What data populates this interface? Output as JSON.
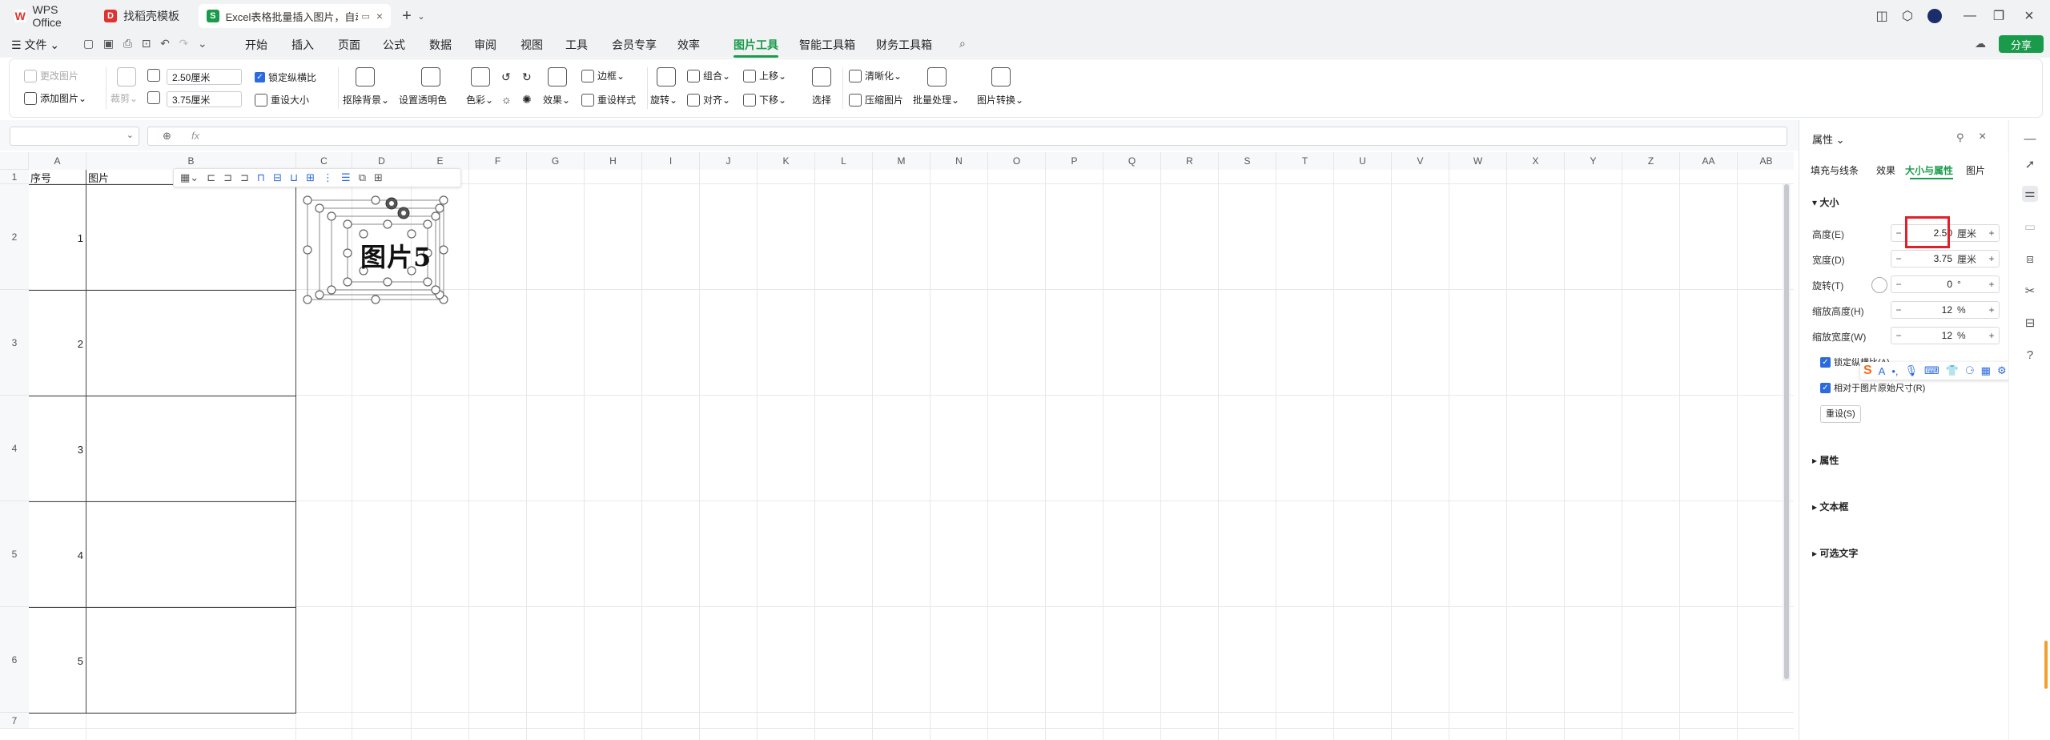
{
  "titlebar": {
    "tabs": [
      {
        "label": "WPS Office",
        "icon": "wps-logo-icon",
        "color": "#e0322f"
      },
      {
        "label": "找稻壳模板",
        "icon": "docer-logo-icon",
        "color": "#e0322f"
      },
      {
        "label": "Excel表格批量插入图片，自动",
        "icon": "spreadsheet-icon",
        "color": "#1a9b4b"
      }
    ],
    "new_tab": "+"
  },
  "menu": {
    "file": "文件",
    "items": [
      "开始",
      "插入",
      "页面",
      "公式",
      "数据",
      "审阅",
      "视图",
      "工具",
      "会员专享",
      "效率",
      "图片工具",
      "智能工具箱",
      "财务工具箱"
    ],
    "active": "图片工具",
    "share": "分享"
  },
  "ribbon": {
    "change_picture": "更改图片",
    "add_picture": "添加图片",
    "crop": "裁剪",
    "height_value": "2.50厘米",
    "width_value": "3.75厘米",
    "lock_ratio": "锁定纵横比",
    "reset_size": "重设大小",
    "remove_bg": "抠除背景",
    "set_transparent": "设置透明色",
    "color": "色彩",
    "effects": "效果",
    "border": "边框",
    "reset_style": "重设样式",
    "rotate": "旋转",
    "group": "组合",
    "align": "对齐",
    "bring_forward": "上移",
    "send_backward": "下移",
    "select": "选择",
    "sharpen": "清晰化",
    "compress": "压缩图片",
    "batch": "批量处理",
    "convert": "图片转换"
  },
  "formula": {
    "fx": "fx",
    "name_box": ""
  },
  "sheet": {
    "columns": [
      "A",
      "B",
      "C",
      "D",
      "E",
      "F",
      "G",
      "H",
      "I",
      "J",
      "K",
      "L",
      "M",
      "N",
      "O",
      "P",
      "Q",
      "R",
      "S",
      "T",
      "U",
      "V",
      "W",
      "X",
      "Y",
      "Z",
      "AA",
      "AB"
    ],
    "rows": [
      "1",
      "2",
      "3",
      "4",
      "5",
      "6",
      "7"
    ],
    "header_a": "序号",
    "header_b": "图片",
    "serials": [
      "1",
      "2",
      "3",
      "4",
      "5"
    ],
    "picture_label": "图片5"
  },
  "panel": {
    "title": "属性",
    "tabs": [
      "填充与线条",
      "效果",
      "大小与属性",
      "图片"
    ],
    "active_tab": "大小与属性",
    "section_size": "大小",
    "fields": [
      {
        "label": "高度(E)",
        "value": "2.50",
        "unit": "厘米"
      },
      {
        "label": "宽度(D)",
        "value": "3.75",
        "unit": "厘米"
      },
      {
        "label": "旋转(T)",
        "value": "0",
        "unit": "°"
      },
      {
        "label": "缩放高度(H)",
        "value": "12",
        "unit": "%"
      },
      {
        "label": "缩放宽度(W)",
        "value": "12",
        "unit": "%"
      }
    ],
    "lock_ratio": "锁定纵横比(A)",
    "relative": "相对于图片原始尺寸(R)",
    "reset": "重设(S)",
    "sections": [
      "属性",
      "文本框",
      "可选文字"
    ],
    "highlight_color": "#e0202a"
  }
}
